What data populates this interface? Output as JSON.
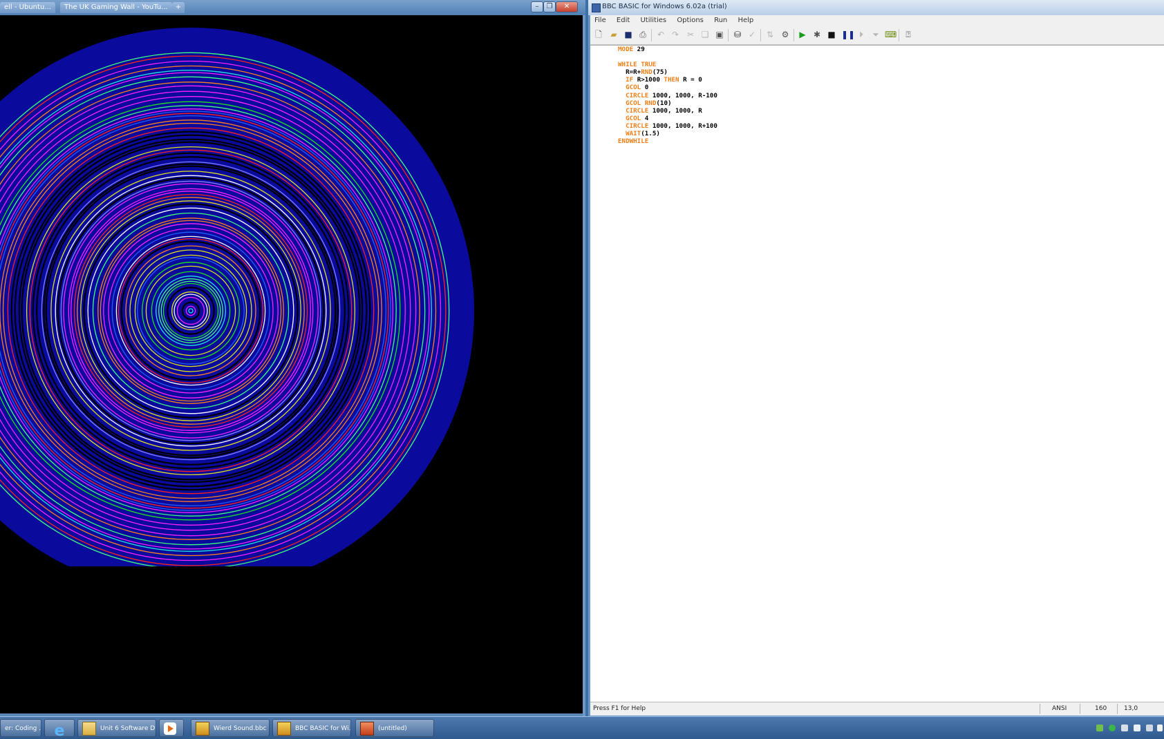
{
  "graphics_window": {
    "tabs": [
      "ell - Ubuntu...",
      "The UK Gaming Wall - YouTu..."
    ],
    "controls": [
      "minimize",
      "restore",
      "close"
    ]
  },
  "ide": {
    "title": "BBC BASIC for Windows 6.02a (trial)",
    "menu": [
      "File",
      "Edit",
      "Utilities",
      "Options",
      "Run",
      "Help"
    ],
    "code_lines": [
      [
        {
          "t": "MODE",
          "k": true
        },
        {
          "t": " 29",
          "k": false
        }
      ],
      [],
      [
        {
          "t": "WHILE TRUE",
          "k": true
        }
      ],
      [
        {
          "t": "  R=R+",
          "k": false
        },
        {
          "t": "RND",
          "k": true
        },
        {
          "t": "(75)",
          "k": false
        }
      ],
      [
        {
          "t": "  ",
          "k": false
        },
        {
          "t": "IF",
          "k": true
        },
        {
          "t": " R>1000 ",
          "k": false
        },
        {
          "t": "THEN",
          "k": true
        },
        {
          "t": " R = 0",
          "k": false
        }
      ],
      [
        {
          "t": "  ",
          "k": false
        },
        {
          "t": "GCOL",
          "k": true
        },
        {
          "t": " 0",
          "k": false
        }
      ],
      [
        {
          "t": "  ",
          "k": false
        },
        {
          "t": "CIRCLE",
          "k": true
        },
        {
          "t": " 1000, 1000, R-100",
          "k": false
        }
      ],
      [
        {
          "t": "  ",
          "k": false
        },
        {
          "t": "GCOL",
          "k": true
        },
        {
          "t": " ",
          "k": false
        },
        {
          "t": "RND",
          "k": true
        },
        {
          "t": "(10)",
          "k": false
        }
      ],
      [
        {
          "t": "  ",
          "k": false
        },
        {
          "t": "CIRCLE",
          "k": true
        },
        {
          "t": " 1000, 1000, R",
          "k": false
        }
      ],
      [
        {
          "t": "  ",
          "k": false
        },
        {
          "t": "GCOL",
          "k": true
        },
        {
          "t": " 4",
          "k": false
        }
      ],
      [
        {
          "t": "  ",
          "k": false
        },
        {
          "t": "CIRCLE",
          "k": true
        },
        {
          "t": " 1000, 1000, R+100",
          "k": false
        }
      ],
      [
        {
          "t": "  ",
          "k": false
        },
        {
          "t": "WAIT",
          "k": true
        },
        {
          "t": "(1.5)",
          "k": false
        }
      ],
      [
        {
          "t": "ENDWHILE",
          "k": true
        }
      ]
    ],
    "status": {
      "help": "Press F1 for Help",
      "encoding": "ANSI",
      "length": "160",
      "position": "13,0"
    }
  },
  "taskbar": {
    "buttons": [
      {
        "label": "er: Coding ...",
        "icon": "none"
      },
      {
        "label": "",
        "icon": "internet-explorer-icon"
      },
      {
        "label": "Unit 6 Software D...",
        "icon": "folder-icon"
      },
      {
        "label": "",
        "icon": "media-player-icon"
      },
      {
        "label": "Wierd Sound.bbc ...",
        "icon": "bbc-basic-icon"
      },
      {
        "label": "BBC BASIC for Wi...",
        "icon": "bbc-basic-icon"
      },
      {
        "label": "(untitled)",
        "icon": "bbc-basic-icon-red"
      }
    ]
  },
  "colors": {
    "keyword": "#f07e14",
    "code_text": "#000000",
    "graphics_background": "#000000",
    "outer_disc": "#0a0a9c"
  }
}
